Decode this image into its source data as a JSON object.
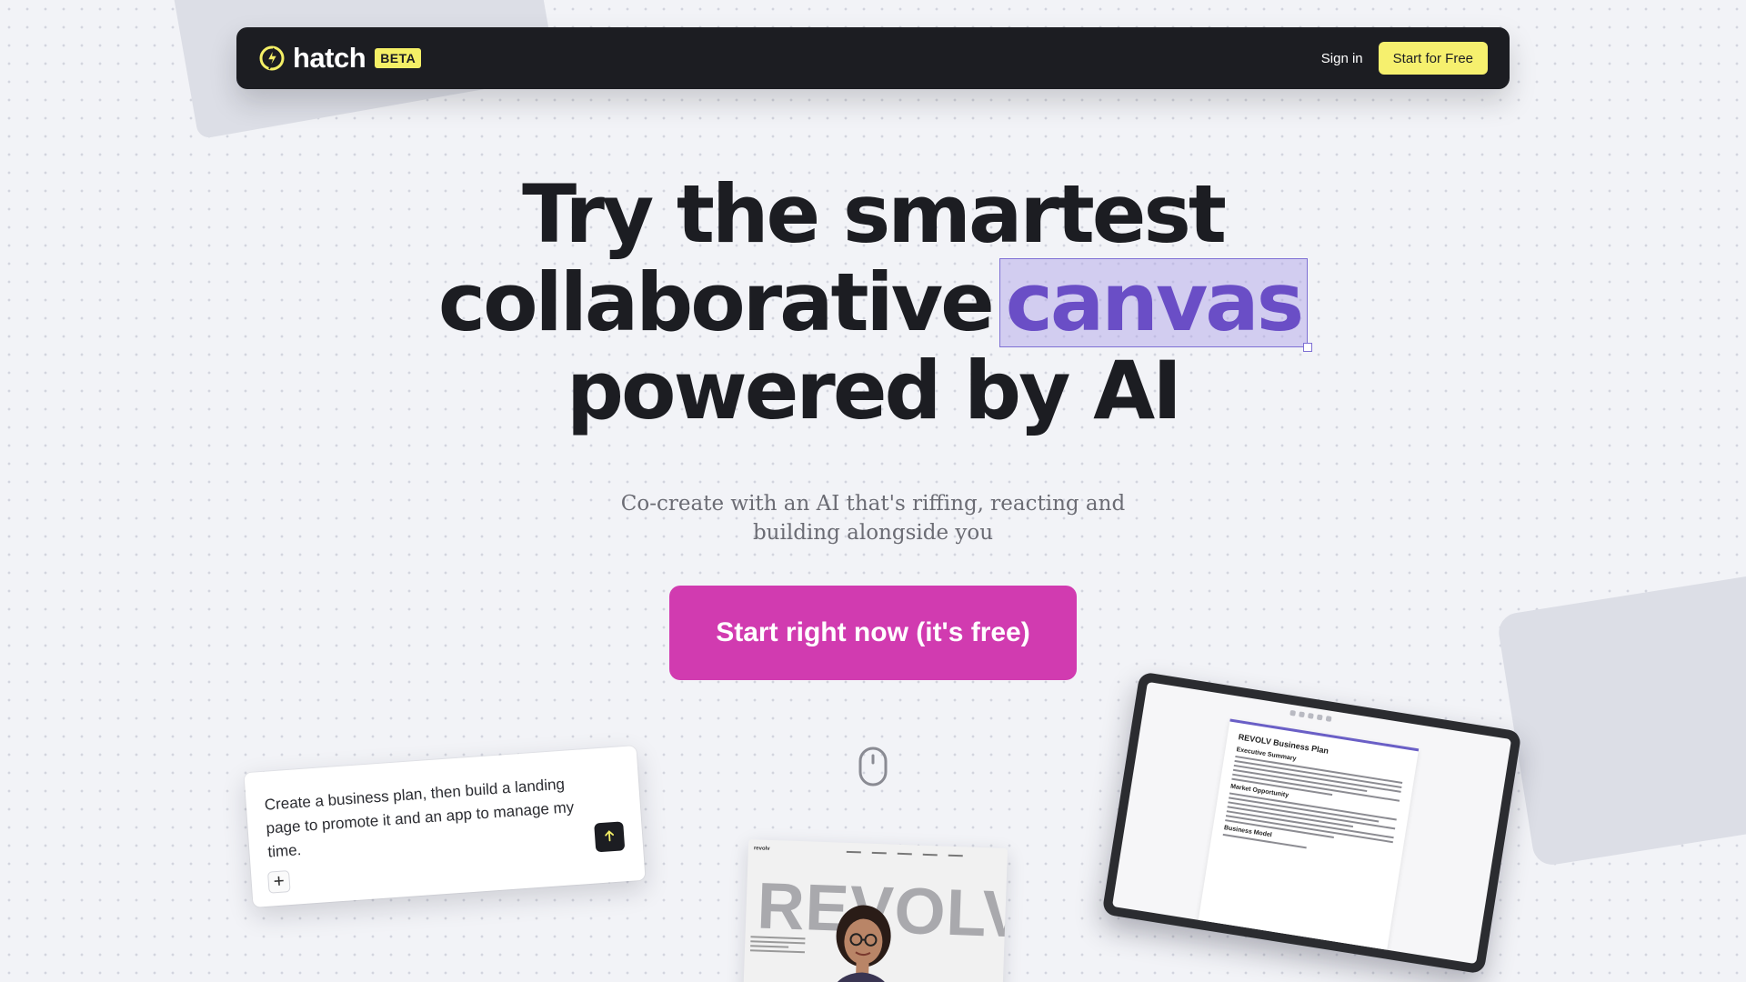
{
  "navbar": {
    "brand_name": "hatch",
    "beta_label": "BETA",
    "signin_label": "Sign in",
    "start_free_label": "Start for Free"
  },
  "hero": {
    "title_line1": "Try the smartest",
    "title_line2": "collaborative",
    "title_highlight": "canvas",
    "title_line3": "powered by AI",
    "subtitle_line1": "Co-create with an AI that's riffing, reacting and",
    "subtitle_line2": "building alongside you",
    "cta_label": "Start right now (it's free)"
  },
  "prompt_card": {
    "text": "Create a business plan, then build a landing page to promote it and an app to manage my time."
  },
  "landing_preview": {
    "logo": "revolv",
    "hero_word": "REVOLV"
  },
  "tablet_doc": {
    "title": "REVOLV Business Plan",
    "heading1": "Executive Summary",
    "heading2": "Market Opportunity",
    "heading3": "Business Model"
  },
  "colors": {
    "accent_yellow": "#f6f06e",
    "cta_magenta": "#d13bb0",
    "highlight_purple": "#6a4ec6",
    "navbar_bg": "#1c1d22"
  },
  "icons": [
    "hatch-logo-icon",
    "mouse-scroll-icon",
    "send-arrow-icon",
    "plus-icon"
  ]
}
